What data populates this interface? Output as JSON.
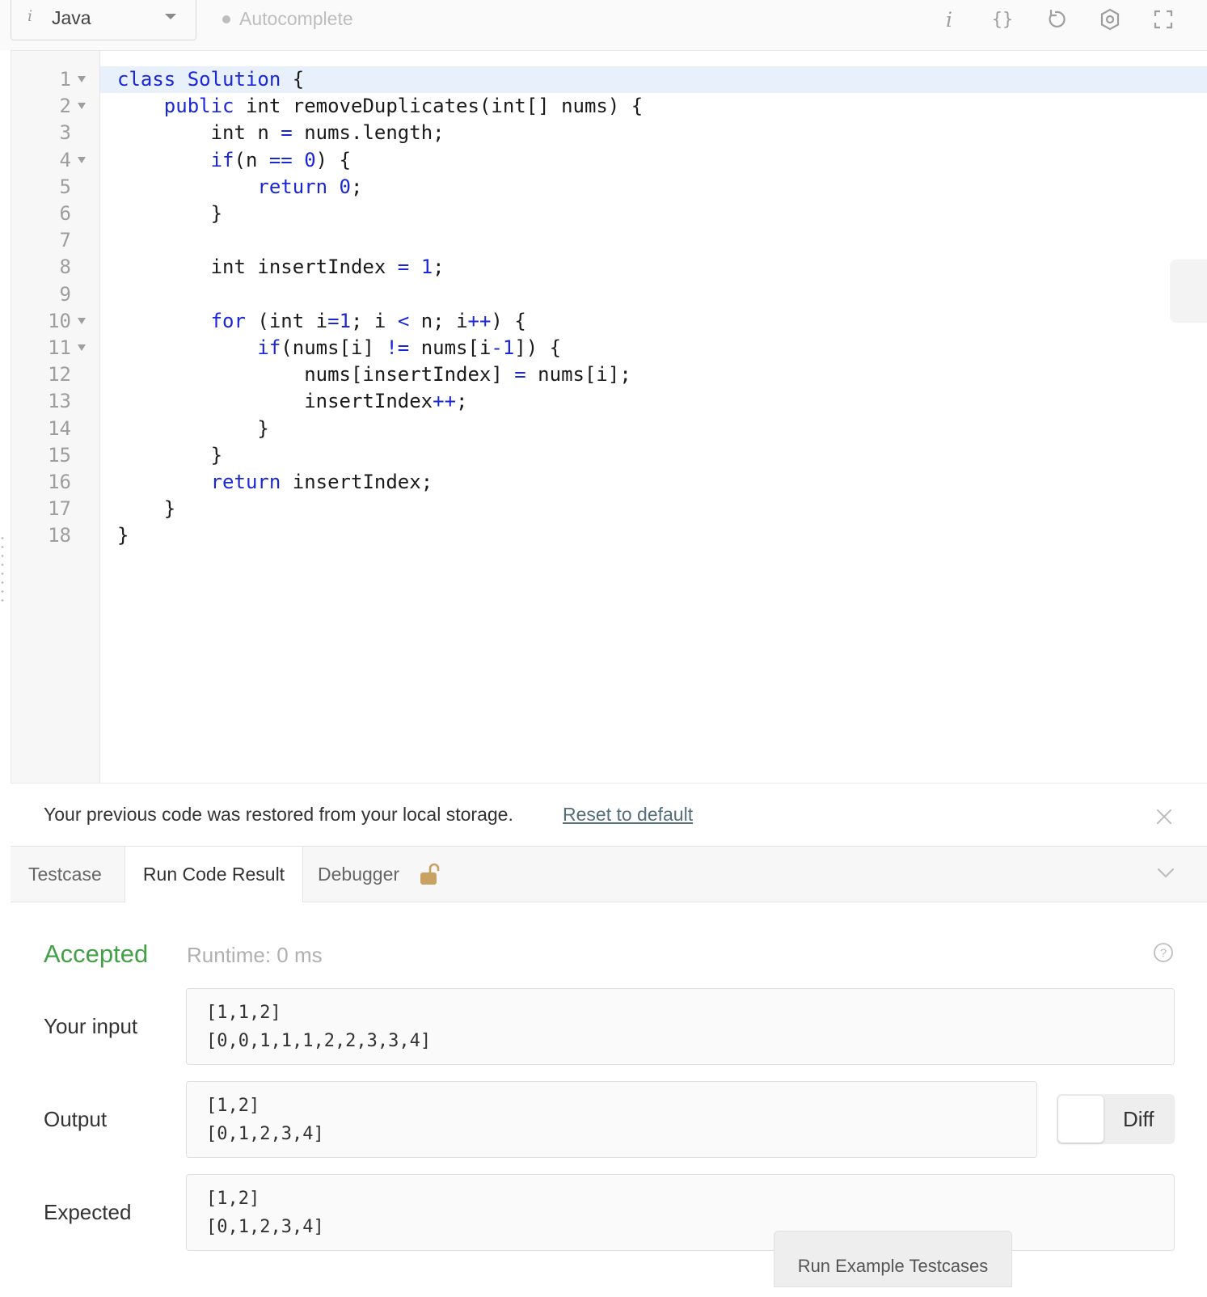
{
  "toolbar": {
    "language_info_glyph": "i",
    "language": "Java",
    "autocomplete_label": "Autocomplete",
    "info_glyph": "i",
    "format_glyph": "{}",
    "icons": [
      "info-icon",
      "braces-icon",
      "reset-icon",
      "settings-icon",
      "fullscreen-icon"
    ]
  },
  "editor": {
    "line_numbers": [
      "1",
      "2",
      "3",
      "4",
      "5",
      "6",
      "7",
      "8",
      "9",
      "10",
      "11",
      "12",
      "13",
      "14",
      "15",
      "16",
      "17",
      "18"
    ],
    "foldable_lines": [
      1,
      2,
      4,
      10,
      11
    ],
    "active_line": 1,
    "code_lines": [
      "class Solution {",
      "    public int removeDuplicates(int[] nums) {",
      "        int n = nums.length;",
      "        if(n == 0) {",
      "            return 0;",
      "        }",
      "",
      "        int insertIndex = 1;",
      "",
      "        for (int i=1; i < n; i++) {",
      "            if(nums[i] != nums[i-1]) {",
      "                nums[insertIndex] = nums[i];",
      "                insertIndex++;",
      "            }",
      "        }",
      "        return insertIndex;",
      "    }",
      "}"
    ],
    "keywords": [
      "class",
      "Solution",
      "public",
      "if",
      "return",
      "for"
    ],
    "colors": {
      "keyword": "#1a27d6",
      "active_line_bg": "#e8f0fb"
    }
  },
  "notice": {
    "text": "Your previous code was restored from your local storage.",
    "reset_link": "Reset to default"
  },
  "tabs": [
    {
      "label": "Testcase",
      "active": false
    },
    {
      "label": "Run Code Result",
      "active": true
    },
    {
      "label": "Debugger",
      "active": false,
      "locked": true
    }
  ],
  "result": {
    "status": "Accepted",
    "runtime": "Runtime: 0 ms",
    "input_label": "Your input",
    "input_lines": [
      "[1,1,2]",
      "[0,0,1,1,1,2,2,3,3,4]"
    ],
    "output_label": "Output",
    "output_lines": [
      "[1,2]",
      "[0,1,2,3,4]"
    ],
    "expected_label": "Expected",
    "expected_lines": [
      "[1,2]",
      "[0,1,2,3,4]"
    ],
    "diff_label": "Diff",
    "diff_enabled": false,
    "run_example_label": "Run Example Testcases",
    "colors": {
      "accepted": "#43a047"
    }
  }
}
